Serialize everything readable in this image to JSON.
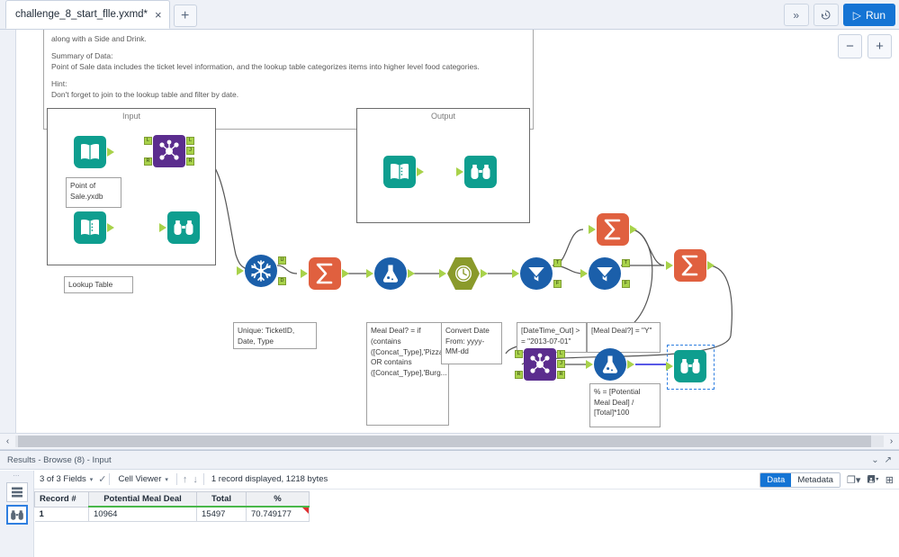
{
  "window": {
    "tab_title": "challenge_8_start_flle.yxmd*",
    "tab_close": "×",
    "tab_add": "+",
    "chevron_more": "»",
    "history_icon": "↺",
    "run_label": "Run",
    "run_icon": "▷"
  },
  "canvas": {
    "zoom_out": "−",
    "zoom_in": "+",
    "comment": {
      "line1": "along with a Side and Drink.",
      "line2": "Summary of Data:",
      "line3": "Point of Sale data includes the ticket level information, and the lookup table categorizes items into higher level food categories.",
      "line4": "Hint:",
      "line5": "Don't forget to join to the lookup table and filter by date."
    },
    "containers": [
      {
        "title": "Input"
      },
      {
        "title": "Output"
      }
    ],
    "tools": {
      "input_pos": "Point of Sale.yxdb",
      "input_lookup": "Lookup Table",
      "join_icon": "join-icon",
      "browse_icon": "browse-icon",
      "unique_icon": "unique-icon",
      "summarize_icon": "summarize-icon",
      "formula_icon": "formula-icon",
      "datetime_icon": "datetime-icon",
      "filter_icon": "filter-icon"
    },
    "annotations": {
      "unique": "Unique: TicketID, Date, Type",
      "formula_meal": "Meal Deal? = if (contains ([Concat_Type],'Pizza') OR contains ([Concat_Type],'Burg...",
      "datetime": "Convert Date From: yyyy-MM-dd",
      "filter_date": "[DateTime_Out] > = \"2013-07-01\"",
      "filter_meal": "[Meal Deal?] = \"Y\"",
      "formula_pct": "% = [Potential Meal Deal] / [Total]*100"
    },
    "ports": {
      "left": "L",
      "join": "J",
      "right": "R",
      "unique_u": "U",
      "unique_d": "D",
      "true": "T",
      "false": "F"
    }
  },
  "hscroll": {
    "left_arrow": "‹",
    "right_arrow": "›"
  },
  "results": {
    "title": "Results - Browse (8) - Input",
    "title_caret": "⌄",
    "fields_label": "3 of 3 Fields",
    "fields_caret": "▾",
    "check_icon": "✓",
    "viewer_label": "Cell Viewer",
    "viewer_caret": "▾",
    "up_arrow": "↑",
    "down_arrow": "↓",
    "status": "1 record displayed, 1218 bytes",
    "data_tab": "Data",
    "metadata_tab": "Metadata",
    "copy_icon": "❐",
    "save_icon": "Ὃe",
    "expand_icon": "⊞",
    "rail_grid_icon": "grid-icon",
    "rail_browse_icon": "browse-icon",
    "columns": [
      "Record #",
      "Potential Meal Deal",
      "Total",
      "%"
    ],
    "rows": [
      {
        "record": "1",
        "potential_meal_deal": "10964",
        "total": "15497",
        "pct": "70.749177"
      }
    ]
  },
  "colors": {
    "accent": "#1574d4",
    "teal": "#0e9e8f",
    "purple": "#5b2d8e",
    "orange": "#e0603f",
    "blue": "#1b5faa",
    "olive": "#8a9a2b",
    "port_green": "#a8d24a",
    "selection": "#2f7fe0"
  }
}
